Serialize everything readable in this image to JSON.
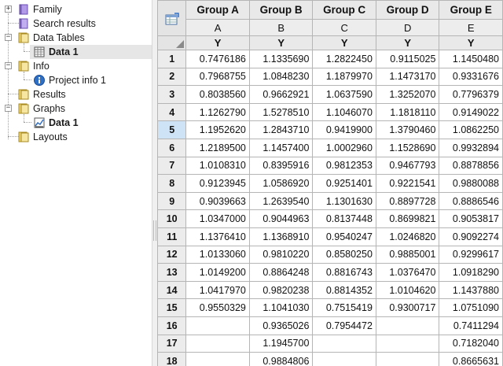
{
  "tree": {
    "family": "Family",
    "search_results": "Search results",
    "data_tables": "Data Tables",
    "data_table_item": "Data 1",
    "info": "Info",
    "project_info": "Project info 1",
    "results": "Results",
    "graphs": "Graphs",
    "graph_item": "Data 1",
    "layouts": "Layouts"
  },
  "table": {
    "groups": [
      "Group A",
      "Group B",
      "Group C",
      "Group D",
      "Group E"
    ],
    "letters": [
      "A",
      "B",
      "C",
      "D",
      "E"
    ],
    "subheader": "Y",
    "row_numbers": [
      "1",
      "2",
      "3",
      "4",
      "5",
      "6",
      "7",
      "8",
      "9",
      "10",
      "11",
      "12",
      "13",
      "14",
      "15",
      "16",
      "17",
      "18"
    ],
    "active_row": "5",
    "rows": [
      [
        "0.7476186",
        "1.1335690",
        "1.2822450",
        "0.9115025",
        "1.1450480"
      ],
      [
        "0.7968755",
        "1.0848230",
        "1.1879970",
        "1.1473170",
        "0.9331676"
      ],
      [
        "0.8038560",
        "0.9662921",
        "1.0637590",
        "1.3252070",
        "0.7796379"
      ],
      [
        "1.1262790",
        "1.5278510",
        "1.1046070",
        "1.1818110",
        "0.9149022"
      ],
      [
        "1.1952620",
        "1.2843710",
        "0.9419900",
        "1.3790460",
        "1.0862250"
      ],
      [
        "1.2189500",
        "1.1457400",
        "1.0002960",
        "1.1528690",
        "0.9932894"
      ],
      [
        "1.0108310",
        "0.8395916",
        "0.9812353",
        "0.9467793",
        "0.8878856"
      ],
      [
        "0.9123945",
        "1.0586920",
        "0.9251401",
        "0.9221541",
        "0.9880088"
      ],
      [
        "0.9039663",
        "1.2639540",
        "1.1301630",
        "0.8897728",
        "0.8886546"
      ],
      [
        "1.0347000",
        "0.9044963",
        "0.8137448",
        "0.8699821",
        "0.9053817"
      ],
      [
        "1.1376410",
        "1.1368910",
        "0.9540247",
        "1.0246820",
        "0.9092274"
      ],
      [
        "1.0133060",
        "0.9810220",
        "0.8580250",
        "0.9885001",
        "0.9299617"
      ],
      [
        "1.0149200",
        "0.8864248",
        "0.8816743",
        "1.0376470",
        "1.0918290"
      ],
      [
        "1.0417970",
        "0.9820238",
        "0.8814352",
        "1.0104620",
        "1.1437880"
      ],
      [
        "0.9550329",
        "1.1041030",
        "0.7515419",
        "0.9300717",
        "1.0751090"
      ],
      [
        "",
        "0.9365026",
        "0.7954472",
        "",
        "0.7411294"
      ],
      [
        "",
        "1.1945700",
        "",
        "",
        "0.7182040"
      ],
      [
        "",
        "0.9884806",
        "",
        "",
        "0.8665631"
      ]
    ]
  }
}
